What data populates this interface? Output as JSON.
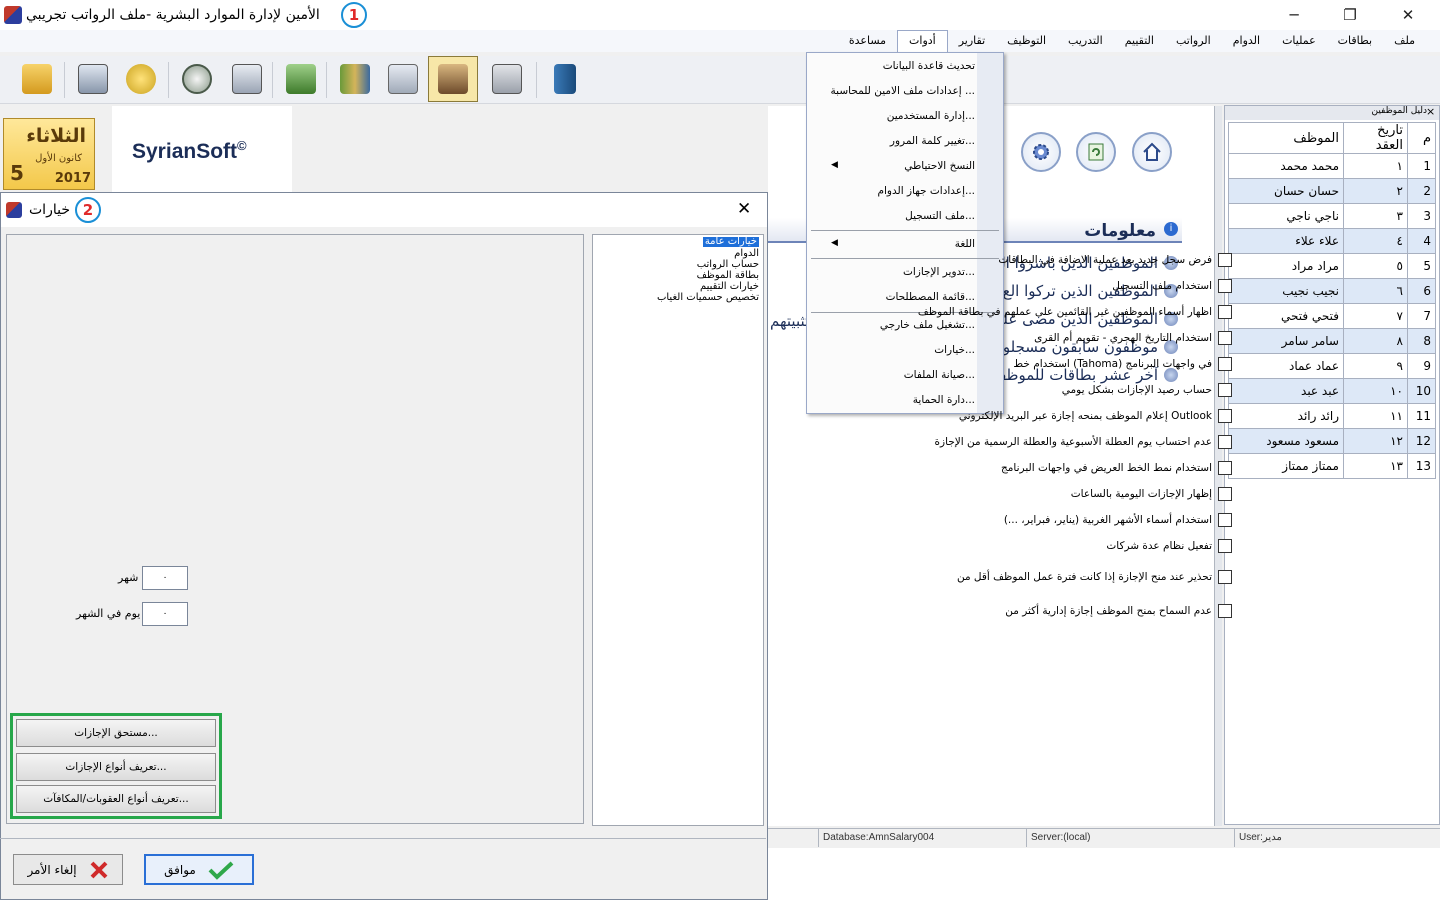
{
  "window": {
    "title": "الأمين لإدارة الموارد البشرية -ملف الرواتب تجريبي",
    "badge_1": "1",
    "minimize": "─",
    "maximize": "❐",
    "close": "✕"
  },
  "menubar": {
    "items": [
      "ملف",
      "بطاقات",
      "عمليات",
      "الدوام",
      "الرواتب",
      "التقييم",
      "التدريب",
      "التوظيف",
      "تقارير",
      "أدوات",
      "مساعدة"
    ],
    "active": "أدوات"
  },
  "toolbar": {
    "icons": [
      "folder-open-icon",
      "employee-card-icon",
      "add-user-icon",
      "clock-icon",
      "calendar-clock-icon",
      "money-icon",
      "books-icon",
      "documents-icon",
      "team-icon",
      "calculator-icon",
      "exit-icon"
    ],
    "pressed_index": 8
  },
  "datebox": {
    "day_name": "الثلاثاء",
    "month": "كانون الأول",
    "day": "5",
    "year": "2017"
  },
  "logo": {
    "text": "SyrianSoft",
    "mark": "©"
  },
  "tools_menu": {
    "items": [
      {
        "label": "تحديث قاعدة البيانات",
        "arrow": false
      },
      {
        "label": "إعدادات ملف الامين للمحاسبة ...",
        "arrow": false
      },
      {
        "label": "إدارة المستخدمين...",
        "arrow": false
      },
      {
        "label": "تغيير كلمة المرور...",
        "arrow": false
      },
      {
        "label": "النسخ الاحتياطي",
        "arrow": true
      },
      {
        "label": "إعدادات جهاز الدوام...",
        "arrow": false
      },
      {
        "label": "ملف التسجيل...",
        "arrow": false
      },
      {
        "label": "اللغة",
        "arrow": true
      },
      {
        "label": "تدوير الإجازات...",
        "arrow": false
      },
      {
        "label": "قائمة المصطلحات...",
        "arrow": false
      },
      {
        "label": "تشغيل ملف خارجي...",
        "arrow": false
      },
      {
        "label": "خيارات...",
        "arrow": false
      },
      {
        "label": "صيانة الملفات...",
        "arrow": false
      },
      {
        "label": "دارة الحماية...",
        "arrow": false
      }
    ]
  },
  "info": {
    "title": "معلومات",
    "links": [
      "الموظفين الذين باشروا ال",
      "الموظفين الذين تركوا الع",
      "الموظفين الذين مضى على",
      "موظفون سابقون مسجلو",
      "آخر عشر بطاقات للموظف"
    ],
    "clipped_text": "تثبيتهم"
  },
  "employees": {
    "panel_title": "دليل الموظفين",
    "close": "×",
    "headers": [
      "م",
      "تاريخ العقد",
      "الموظف"
    ],
    "rows": [
      [
        "1",
        "١",
        "محمد محمد"
      ],
      [
        "2",
        "٢",
        "حسان حسان"
      ],
      [
        "3",
        "٣",
        "ناجي ناجي"
      ],
      [
        "4",
        "٤",
        "علاء علاء"
      ],
      [
        "5",
        "٥",
        "مراد مراد"
      ],
      [
        "6",
        "٦",
        "نجيب نجيب"
      ],
      [
        "7",
        "٧",
        "فتحي فتحي"
      ],
      [
        "8",
        "٨",
        "سامر سامر"
      ],
      [
        "9",
        "٩",
        "عماد عماد"
      ],
      [
        "10",
        "١٠",
        "عبد عبد"
      ],
      [
        "11",
        "١١",
        "رائد رائد"
      ],
      [
        "12",
        "١٢",
        "مسعود مسعود"
      ],
      [
        "13",
        "١٣",
        "ممتاز ممتاز"
      ]
    ]
  },
  "status": {
    "database": "Database:AmnSalary004",
    "server": "Server:(local)",
    "user": "User:مدير"
  },
  "dialog": {
    "title": "خيارات",
    "badge_2": "2",
    "close": "✕",
    "options": [
      "فرض سجل جديد بعد عملية الاضافة في البطاقات",
      "استخدام ملف التسجيل",
      "اظهار أسماء الموظفين غير القائمين على عملهم في بطاقة الموظف",
      "استخدام التاريخ الهجري - تقويم أم القرى",
      "استخدام خط (Tahoma) في واجهات البرنامج",
      "حساب رصيد الإجازات بشكل يومي",
      "إعلام الموظف بمنحه إجازة عبر البريد الإلكتروني Outlook",
      "عدم احتساب يوم العطلة الأسبوعية والعطلة الرسمية من الإجازة",
      "استخدام نمط الخط العريض في واجهات البرنامج",
      "إظهار الإجازات اليومية بالساعات",
      "استخدام أسماء الأشهر الغربية (يناير، فبراير، ...)",
      "تفعيل نظام عدة شركات"
    ],
    "warn_option": "تحذير عند منح الإجازة إذا كانت فترة عمل الموظف أقل من",
    "warn_value": "٠",
    "warn_unit": "شهر",
    "limit_option": "عدم السماح بمنح الموظف إجازة إدارية أكثر من",
    "limit_value": "٠",
    "limit_unit": "يوم في الشهر",
    "categories": [
      "خيارات عامة",
      "الدوام",
      "حساب الرواتب",
      "بطاقة الموظف",
      "خيارات التقييم",
      "تخصيص حسميات الغياب"
    ],
    "buttons": {
      "leave_entitlement": "مستحق الإجازات...",
      "leave_types": "تعريف أنواع الإجازات...",
      "penalty_types": "تعريف أنواع العقوبات/المكافآت..."
    },
    "ok": "موافق",
    "cancel": "إلغاء الأمر"
  },
  "colors": {
    "accent_blue": "#1e6fd9",
    "highlight_green": "#27a74a",
    "badge_red": "#e02a2a",
    "row_alt": "#dde8f7"
  }
}
